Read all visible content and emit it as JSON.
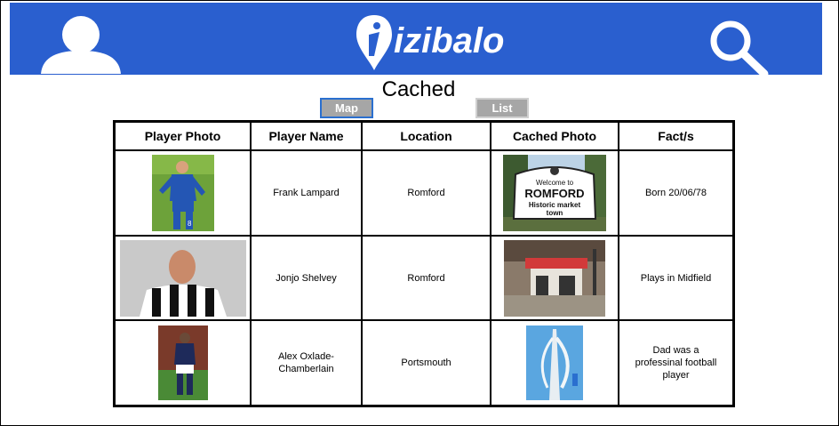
{
  "header": {
    "logo_text": "izibalo",
    "colors": {
      "bar": "#2a5fcf",
      "icon": "#ffffff"
    },
    "icons": [
      "user-avatar-icon",
      "izibalo-logo",
      "search-icon"
    ]
  },
  "page_title": "Cached",
  "buttons": {
    "map_label": "Map",
    "list_label": "List"
  },
  "table": {
    "headers": [
      "Player Photo",
      "Player Name",
      "Location",
      "Cached Photo",
      "Fact/s"
    ],
    "rows": [
      {
        "player_name": "Frank Lampard",
        "location": "Romford",
        "fact": "Born 20/06/78",
        "cached_sign": {
          "line1": "Welcome to",
          "line2": "ROMFORD",
          "line3": "Historic market",
          "line4": "town"
        }
      },
      {
        "player_name": "Jonjo Shelvey",
        "location": "Romford",
        "fact": "Plays in Midfield"
      },
      {
        "player_name": "Alex Oxlade-Chamberlain",
        "location": "Portsmouth",
        "fact": "Dad was a professinal football player"
      }
    ]
  }
}
